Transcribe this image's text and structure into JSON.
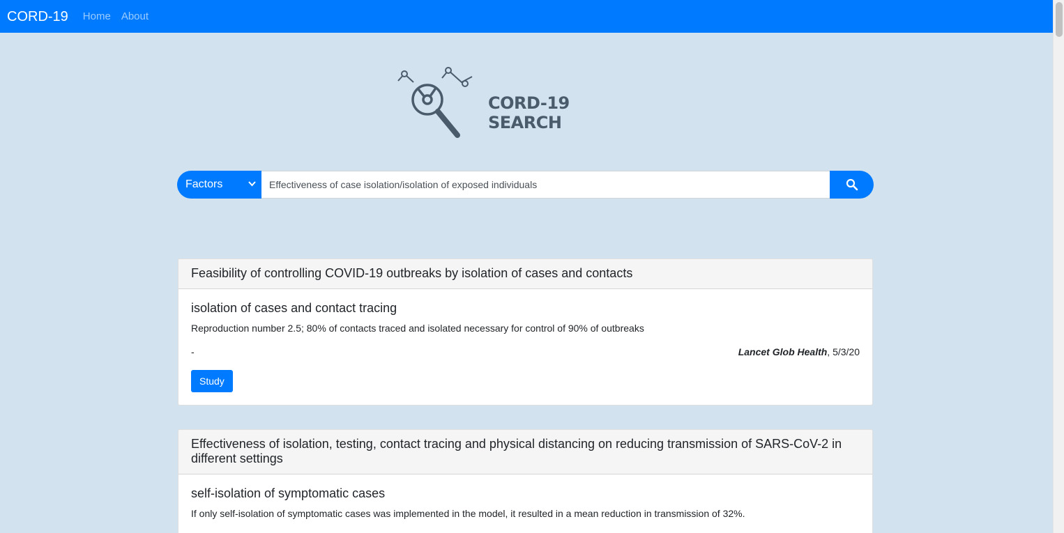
{
  "navbar": {
    "brand": "CORD-19",
    "links": [
      "Home",
      "About"
    ]
  },
  "logo": {
    "text": "CORD-19 SEARCH",
    "icon": "magnifier-chart-icon"
  },
  "search": {
    "category": "Factors",
    "query": "Effectiveness of case isolation/isolation of exposed individuals",
    "button_icon": "search-icon"
  },
  "results": [
    {
      "title": "Feasibility of controlling COVID-19 outbreaks by isolation of cases and contacts",
      "factor": "isolation of cases and contact tracing",
      "finding": "Reproduction number 2.5; 80% of contacts traced and isolated necessary for control of 90% of outbreaks",
      "meta_left": "-",
      "journal": "Lancet Glob Health",
      "date": ", 5/3/20",
      "button": "Study"
    },
    {
      "title": "Effectiveness of isolation, testing, contact tracing and physical distancing on reducing transmission of SARS-CoV-2 in different settings",
      "factor": "self-isolation of symptomatic cases",
      "finding": "If only self-isolation of symptomatic cases was implemented in the model, it resulted in a mean reduction in transmission of 32%."
    }
  ],
  "colors": {
    "primary": "#007bff",
    "background": "#d3e2ef",
    "logo_text": "#4a5b6b"
  }
}
